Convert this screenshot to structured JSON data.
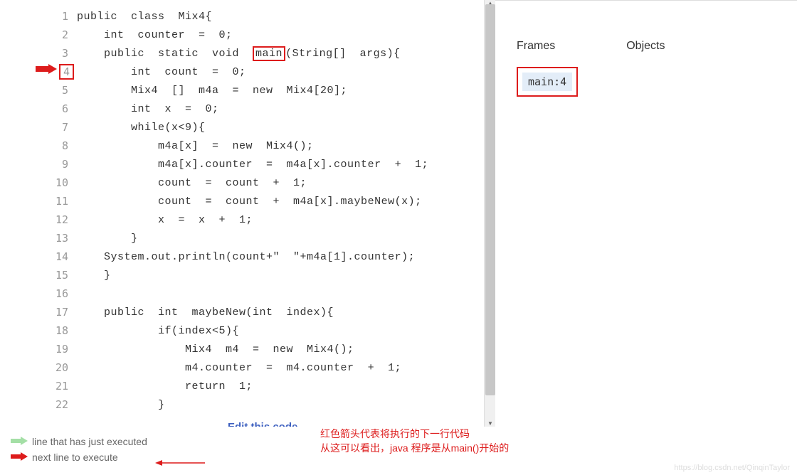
{
  "code": {
    "lines": [
      {
        "n": "1",
        "text": "public  class  Mix4{"
      },
      {
        "n": "2",
        "text": "    int  counter  =  0;"
      },
      {
        "n": "3",
        "text": "    public  static  void  ",
        "main": "main",
        "after": "(String[]  args){"
      },
      {
        "n": "4",
        "text": "        int  count  =  0;",
        "highlight": true
      },
      {
        "n": "5",
        "text": "        Mix4  []  m4a  =  new  Mix4[20];"
      },
      {
        "n": "6",
        "text": "        int  x  =  0;"
      },
      {
        "n": "7",
        "text": "        while(x<9){"
      },
      {
        "n": "8",
        "text": "            m4a[x]  =  new  Mix4();"
      },
      {
        "n": "9",
        "text": "            m4a[x].counter  =  m4a[x].counter  +  1;"
      },
      {
        "n": "10",
        "text": "            count  =  count  +  1;"
      },
      {
        "n": "11",
        "text": "            count  =  count  +  m4a[x].maybeNew(x);"
      },
      {
        "n": "12",
        "text": "            x  =  x  +  1;"
      },
      {
        "n": "13",
        "text": "        }"
      },
      {
        "n": "14",
        "text": "    System.out.println(count+\"  \"+m4a[1].counter);"
      },
      {
        "n": "15",
        "text": "    }"
      },
      {
        "n": "16",
        "text": ""
      },
      {
        "n": "17",
        "text": "    public  int  maybeNew(int  index){"
      },
      {
        "n": "18",
        "text": "            if(index<5){"
      },
      {
        "n": "19",
        "text": "                Mix4  m4  =  new  Mix4();"
      },
      {
        "n": "20",
        "text": "                m4.counter  =  m4.counter  +  1;"
      },
      {
        "n": "21",
        "text": "                return  1;"
      },
      {
        "n": "22",
        "text": "            }"
      }
    ],
    "edit_link": "Edit this code"
  },
  "right": {
    "frames_header": "Frames",
    "objects_header": "Objects",
    "frame_value": "main:4"
  },
  "legend": {
    "executed": "line that has just executed",
    "next": "next line to execute"
  },
  "annotation": {
    "line1": "红色箭头代表将执行的下一行代码",
    "line2": "从这可以看出，java 程序是从main()开始的"
  },
  "watermark": "https://blog.csdn.net/QinqinTaylor"
}
